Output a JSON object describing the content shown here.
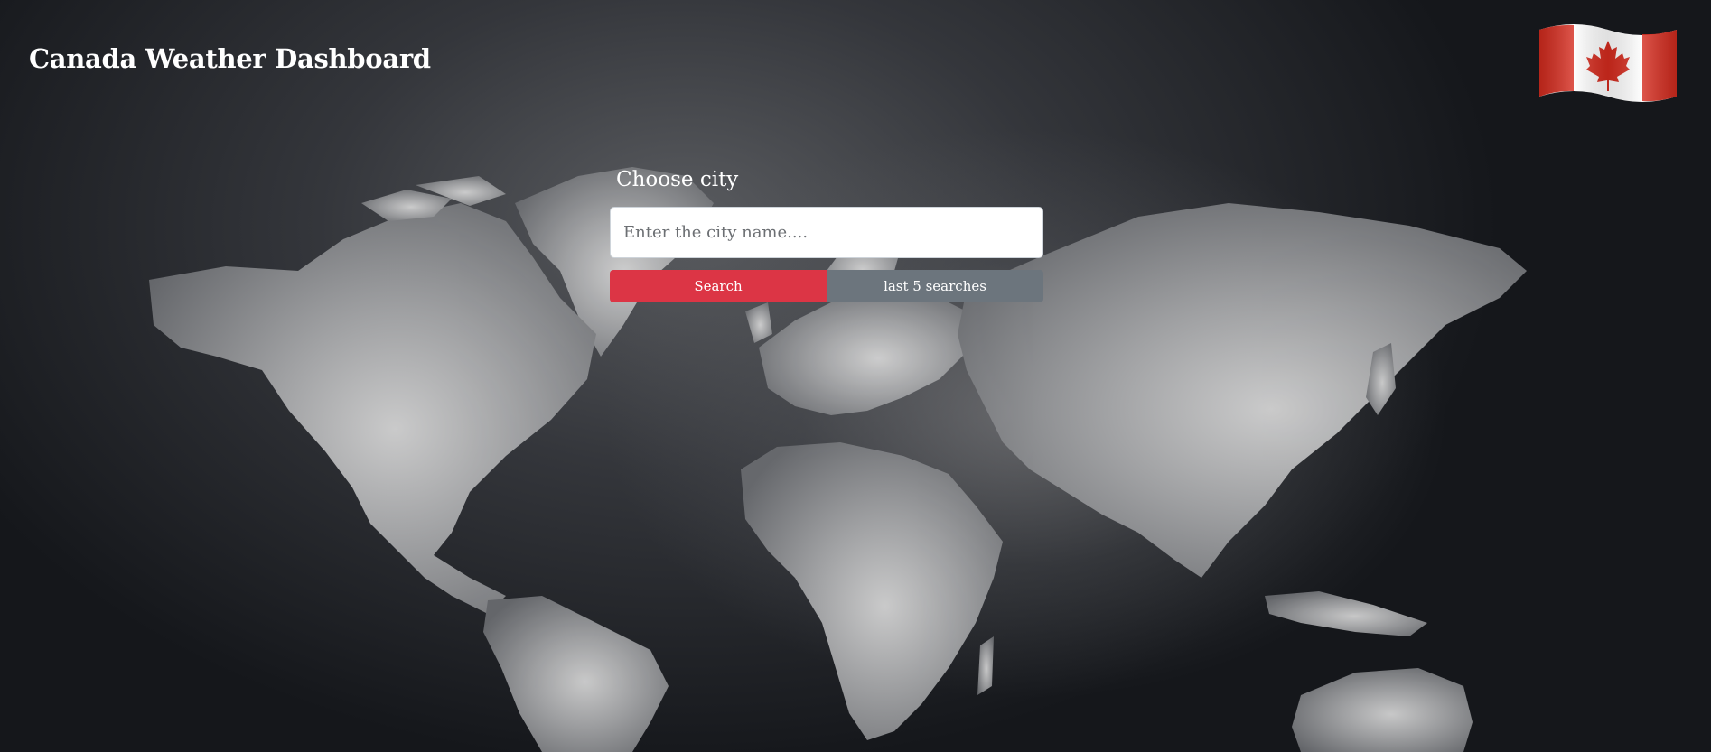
{
  "header": {
    "title": "Canada Weather Dashboard",
    "flag_icon": "canada-flag-icon"
  },
  "search": {
    "label": "Choose city",
    "placeholder": "Enter the city name....",
    "value": "",
    "search_button": "Search",
    "history_button": "last 5 searches"
  },
  "colors": {
    "search_button": "#dc3545",
    "history_button": "#6c757d",
    "flag_red": "#d52b1e",
    "flag_white": "#ffffff"
  },
  "background": {
    "image_icon": "world-map-background"
  }
}
